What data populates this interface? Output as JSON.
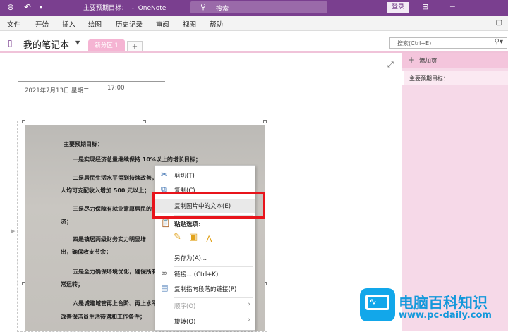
{
  "titlebar": {
    "title": "主要预期目标：  -  OneNote",
    "search_label": "搜索",
    "login_label": "登录",
    "icons": [
      "back-icon",
      "undo-icon",
      "dropdown-icon",
      "search-icon",
      "ribbon-display-icon",
      "minimize-icon"
    ]
  },
  "ribbon": {
    "tabs": [
      "文件",
      "开始",
      "插入",
      "绘图",
      "历史记录",
      "审阅",
      "视图",
      "帮助"
    ]
  },
  "notebook": {
    "name": "我的笔记本",
    "section_tab": "新分区 1",
    "add_tab": "+",
    "search_placeholder": "搜索(Ctrl+E)"
  },
  "page": {
    "date": "2021年7月13日 星期二",
    "time": "17:00"
  },
  "document_lines": [
    "主要预期目标：",
    "一是实现经济总量继续保持 10%以上的增长目标；",
    "二是居民生活水平得到持续改善，",
    "人均可支配收入增加 500 元以上；",
    "三是尽力保障有就业意愿居民的",
    "济；",
    "四是镇居两级财务实力明显增",
    "出，确保收支节余；",
    "五是全力确保环境优化，确保所有",
    "常运转；",
    "六是城建城管再上台阶、再上水平",
    "改善保洁员生活待遇和工作条件；"
  ],
  "pagelist": {
    "add_page": "添加页",
    "pages": [
      "主要预期目标："
    ]
  },
  "context_menu": {
    "cut": "剪切(T)",
    "copy": "复制(C)",
    "copy_text": "复制图片中的文本(E)",
    "paste_options": "粘贴选项:",
    "save_as": "另存为(A)...",
    "link": "链接...  (Ctrl+K)",
    "copy_link": "复制指向段落的链接(P)",
    "order": "顺序(O)",
    "rotate": "旋转(O)"
  },
  "watermark": {
    "title": "电脑百科知识",
    "url": "www.pc-daily.com"
  },
  "colors": {
    "titlebar": "#7a3f8f",
    "section_tab": "#f5b4d3",
    "pagelist": "#f6d9e8",
    "highlight_box": "#e8141b",
    "watermark": "#1398db"
  }
}
